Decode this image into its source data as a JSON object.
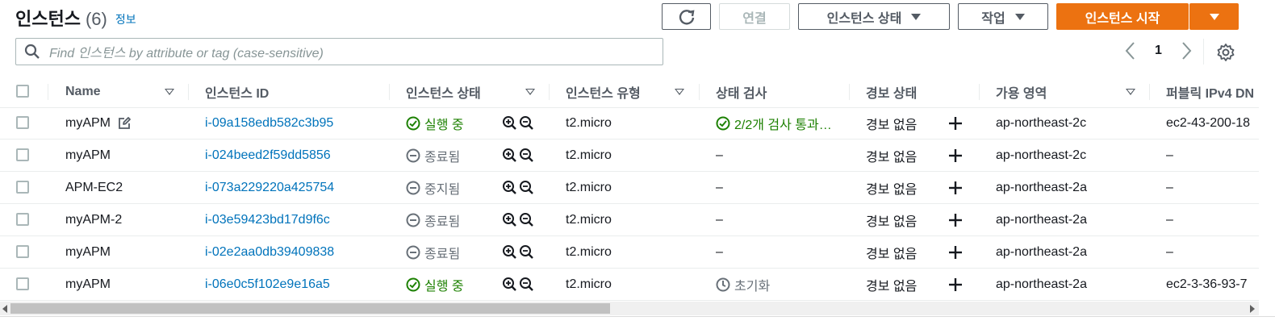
{
  "header": {
    "title": "인스턴스",
    "count": "(6)",
    "info_link": "정보"
  },
  "toolbar": {
    "refresh_icon": "refresh-icon",
    "connect_label": "연결",
    "instance_state_label": "인스턴스 상태",
    "actions_label": "작업",
    "launch_label": "인스턴스 시작"
  },
  "search": {
    "placeholder": "Find 인스턴스 by attribute or tag (case-sensitive)"
  },
  "pagination": {
    "current_page": "1"
  },
  "columns": [
    "Name",
    "인스턴스 ID",
    "인스턴스 상태",
    "인스턴스 유형",
    "상태 검사",
    "경보 상태",
    "가용 영역",
    "퍼블릭 IPv4 DN"
  ],
  "rows": [
    {
      "name": "myAPM",
      "id": "i-09a158edb582c3b95",
      "state": "실행 중",
      "state_kind": "running",
      "type": "t2.micro",
      "check": "2/2개 검사 통과…",
      "check_kind": "passed",
      "alarm": "경보 없음",
      "az": "ap-northeast-2c",
      "dns": "ec2-43-200-18",
      "editable": true
    },
    {
      "name": "myAPM",
      "id": "i-024beed2f59dd5856",
      "state": "종료됨",
      "state_kind": "terminated",
      "type": "t2.micro",
      "check": "–",
      "check_kind": "none",
      "alarm": "경보 없음",
      "az": "ap-northeast-2c",
      "dns": "–",
      "editable": false
    },
    {
      "name": "APM-EC2",
      "id": "i-073a229220a425754",
      "state": "중지됨",
      "state_kind": "stopped",
      "type": "t2.micro",
      "check": "–",
      "check_kind": "none",
      "alarm": "경보 없음",
      "az": "ap-northeast-2a",
      "dns": "–",
      "editable": false
    },
    {
      "name": "myAPM-2",
      "id": "i-03e59423bd17d9f6c",
      "state": "종료됨",
      "state_kind": "terminated",
      "type": "t2.micro",
      "check": "–",
      "check_kind": "none",
      "alarm": "경보 없음",
      "az": "ap-northeast-2a",
      "dns": "–",
      "editable": false
    },
    {
      "name": "myAPM",
      "id": "i-02e2aa0db39409838",
      "state": "종료됨",
      "state_kind": "terminated",
      "type": "t2.micro",
      "check": "–",
      "check_kind": "none",
      "alarm": "경보 없음",
      "az": "ap-northeast-2a",
      "dns": "–",
      "editable": false
    },
    {
      "name": "myAPM",
      "id": "i-06e0c5f102e9e16a5",
      "state": "실행 중",
      "state_kind": "running",
      "type": "t2.micro",
      "check": "초기화",
      "check_kind": "initializing",
      "alarm": "경보 없음",
      "az": "ap-northeast-2a",
      "dns": "ec2-3-36-93-7",
      "editable": false
    }
  ],
  "colors": {
    "primary": "#ec7211",
    "link": "#0073bb",
    "success": "#1d8102",
    "muted": "#687078"
  }
}
